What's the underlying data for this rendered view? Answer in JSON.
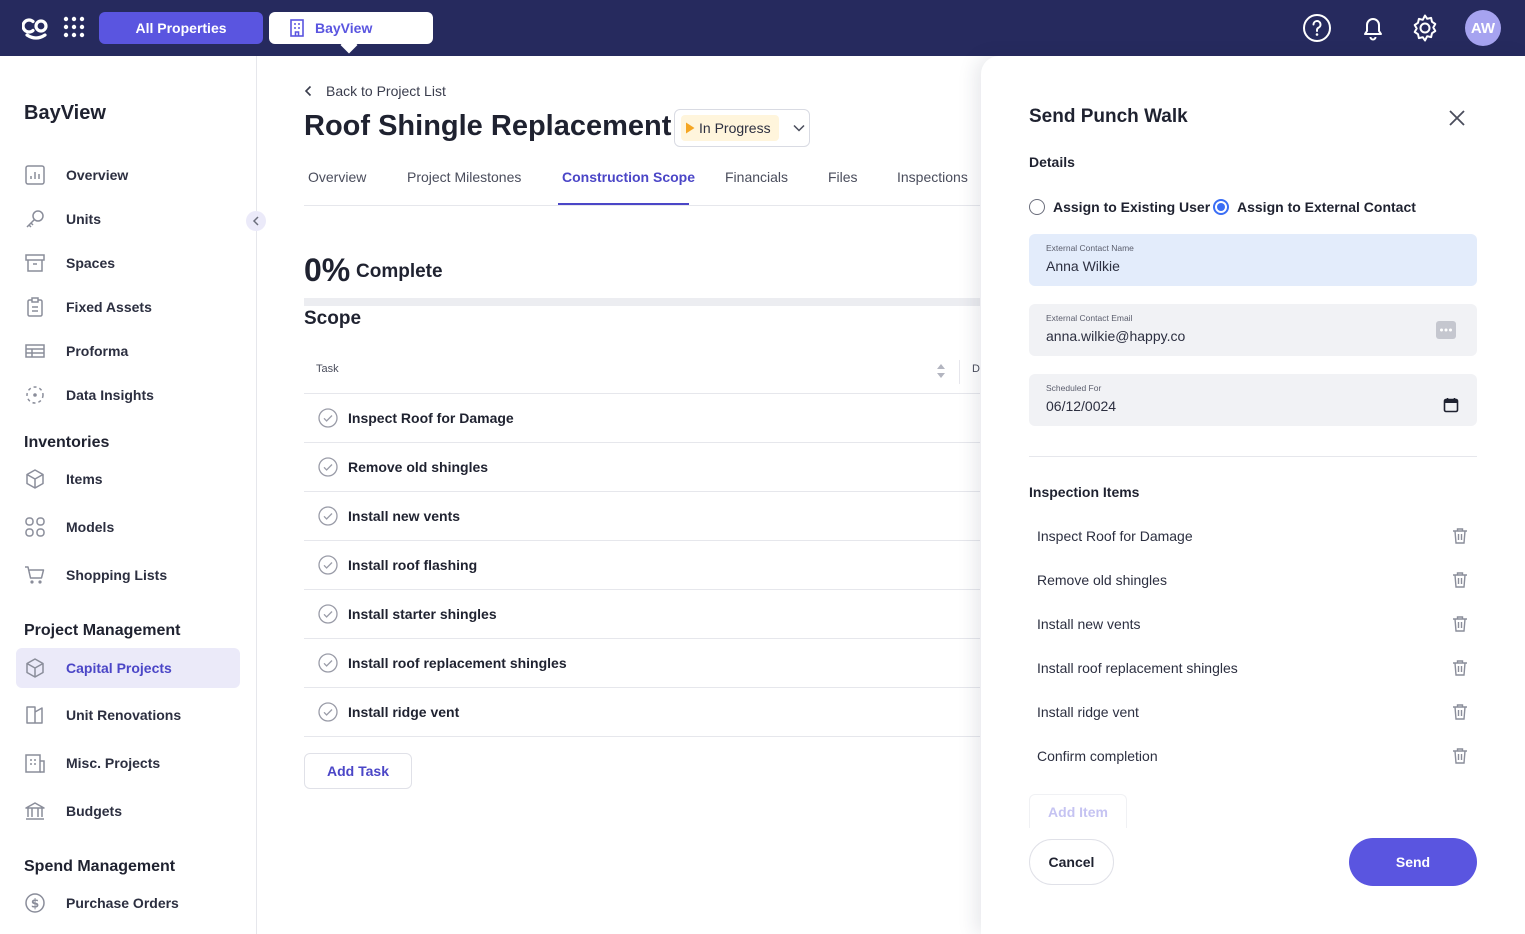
{
  "topbar": {
    "all_properties_label": "All Properties",
    "property_tab_label": "BayView",
    "avatar_initials": "AW"
  },
  "sidebar": {
    "title": "BayView",
    "items": [
      {
        "label": "Overview",
        "icon": "chart-icon"
      },
      {
        "label": "Units",
        "icon": "key-icon"
      },
      {
        "label": "Spaces",
        "icon": "box-icon"
      },
      {
        "label": "Fixed Assets",
        "icon": "clipboard-icon"
      },
      {
        "label": "Proforma",
        "icon": "table-icon"
      },
      {
        "label": "Data Insights",
        "icon": "insights-icon"
      }
    ],
    "inventories": {
      "heading": "Inventories",
      "items": [
        {
          "label": "Items",
          "icon": "cube-icon"
        },
        {
          "label": "Models",
          "icon": "grid-icon"
        },
        {
          "label": "Shopping Lists",
          "icon": "cart-icon"
        }
      ]
    },
    "project_management": {
      "heading": "Project Management",
      "items": [
        {
          "label": "Capital Projects",
          "icon": "cube-icon",
          "active": true
        },
        {
          "label": "Unit Renovations",
          "icon": "renovation-icon"
        },
        {
          "label": "Misc. Projects",
          "icon": "building-icon"
        },
        {
          "label": "Budgets",
          "icon": "bank-icon"
        }
      ]
    },
    "spend_management": {
      "heading": "Spend Management",
      "items": [
        {
          "label": "Purchase Orders",
          "icon": "dollar-icon"
        }
      ]
    }
  },
  "main": {
    "back_label": "Back to Project List",
    "title": "Roof Shingle Replacement",
    "status": "In Progress",
    "tabs": [
      {
        "label": "Overview"
      },
      {
        "label": "Project Milestones"
      },
      {
        "label": "Construction Scope",
        "active": true
      },
      {
        "label": "Financials"
      },
      {
        "label": "Files"
      },
      {
        "label": "Inspections"
      }
    ],
    "progress_value": "0%",
    "progress_label": "Complete",
    "progress_fraction": 0,
    "scope_heading": "Scope",
    "table": {
      "col_task": "Task",
      "col_d": "D",
      "rows": [
        "Inspect Roof for Damage",
        "Remove old shingles",
        "Install new vents",
        "Install roof flashing",
        "Install starter shingles",
        "Install roof replacement shingles",
        "Install ridge vent"
      ]
    },
    "add_task_label": "Add Task"
  },
  "drawer": {
    "title": "Send Punch Walk",
    "details_heading": "Details",
    "radio_existing": "Assign to Existing User",
    "radio_external": "Assign to External Contact",
    "selected_option": "external",
    "name_field": {
      "label": "External Contact Name",
      "value": "Anna Wilkie"
    },
    "email_field": {
      "label": "External Contact Email",
      "value": "anna.wilkie@happy.co"
    },
    "date_field": {
      "label": "Scheduled For",
      "value": "06/12/0024"
    },
    "items_heading": "Inspection Items",
    "items": [
      "Inspect Roof for Damage",
      "Remove old shingles",
      "Install new vents",
      "Install roof replacement shingles",
      "Install ridge vent",
      "Confirm completion"
    ],
    "add_item_label": "Add Item",
    "cancel_label": "Cancel",
    "send_label": "Send"
  },
  "colors": {
    "nav_bg": "#262a5e",
    "accent": "#5a55e0",
    "active_text": "#4b46c7",
    "status_icon": "#f5a623"
  }
}
